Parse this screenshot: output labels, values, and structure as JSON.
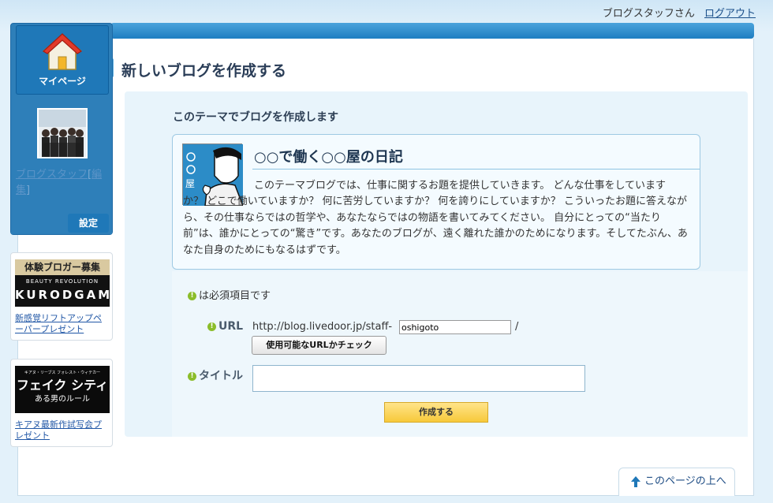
{
  "header": {
    "user_name": "ブログスタッフさん",
    "logout_label": "ログアウト"
  },
  "sidebar": {
    "mypage_label": "マイページ",
    "user_link": "ブログスタッフ",
    "edit_open": "[",
    "edit_label": "編集",
    "edit_close": "]",
    "settings_label": "設定"
  },
  "promos": [
    {
      "banner_top": "体験ブロガー募集",
      "banner_mid": "BEAUTY REVOLUTION",
      "banner_brand": "KURODGAMI",
      "link": "新感覚リフトアップペーパープレゼント"
    },
    {
      "banner_small": "キアヌ・リーブス フォレスト・ウィテカー",
      "banner_title": "フェイク シティ",
      "banner_sub": "ある男のルール",
      "link": "キアヌ最新作試写会プレゼント"
    }
  ],
  "main": {
    "page_title": "新しいブログを作成する",
    "theme_heading": "このテーマでブログを作成します",
    "theme_title": "○○で働く○○屋の日記",
    "theme_desc_first": "このテーマブログでは、仕事に関するお題を提供していきます。 どんな仕事をしています",
    "theme_desc_rest": "か？ どこで働いていますか？ 何に苦労していますか？ 何を誇りにしていますか？ こういったお題に答えながら、その仕事ならではの哲学や、あなたならではの物語を書いてみてください。 自分にとっての“当たり前”は、誰かにとっての“驚き”です。あなたのブログが、遠く離れた誰かのためになります。そしてたぶん、あなた自身のためにもなるはずです。",
    "thumb_text": "○○屋"
  },
  "form": {
    "required_note": "は必須項目です",
    "url_label": "URL",
    "url_prefix": "http://blog.livedoor.jp/staff-",
    "url_value": "oshigoto",
    "url_suffix": "/",
    "check_button": "使用可能なURLかチェック",
    "title_label": "タイトル",
    "title_value": "",
    "create_button": "作成する",
    "required_icon": "!"
  },
  "footer": {
    "to_top_label": "このページの上へ"
  }
}
